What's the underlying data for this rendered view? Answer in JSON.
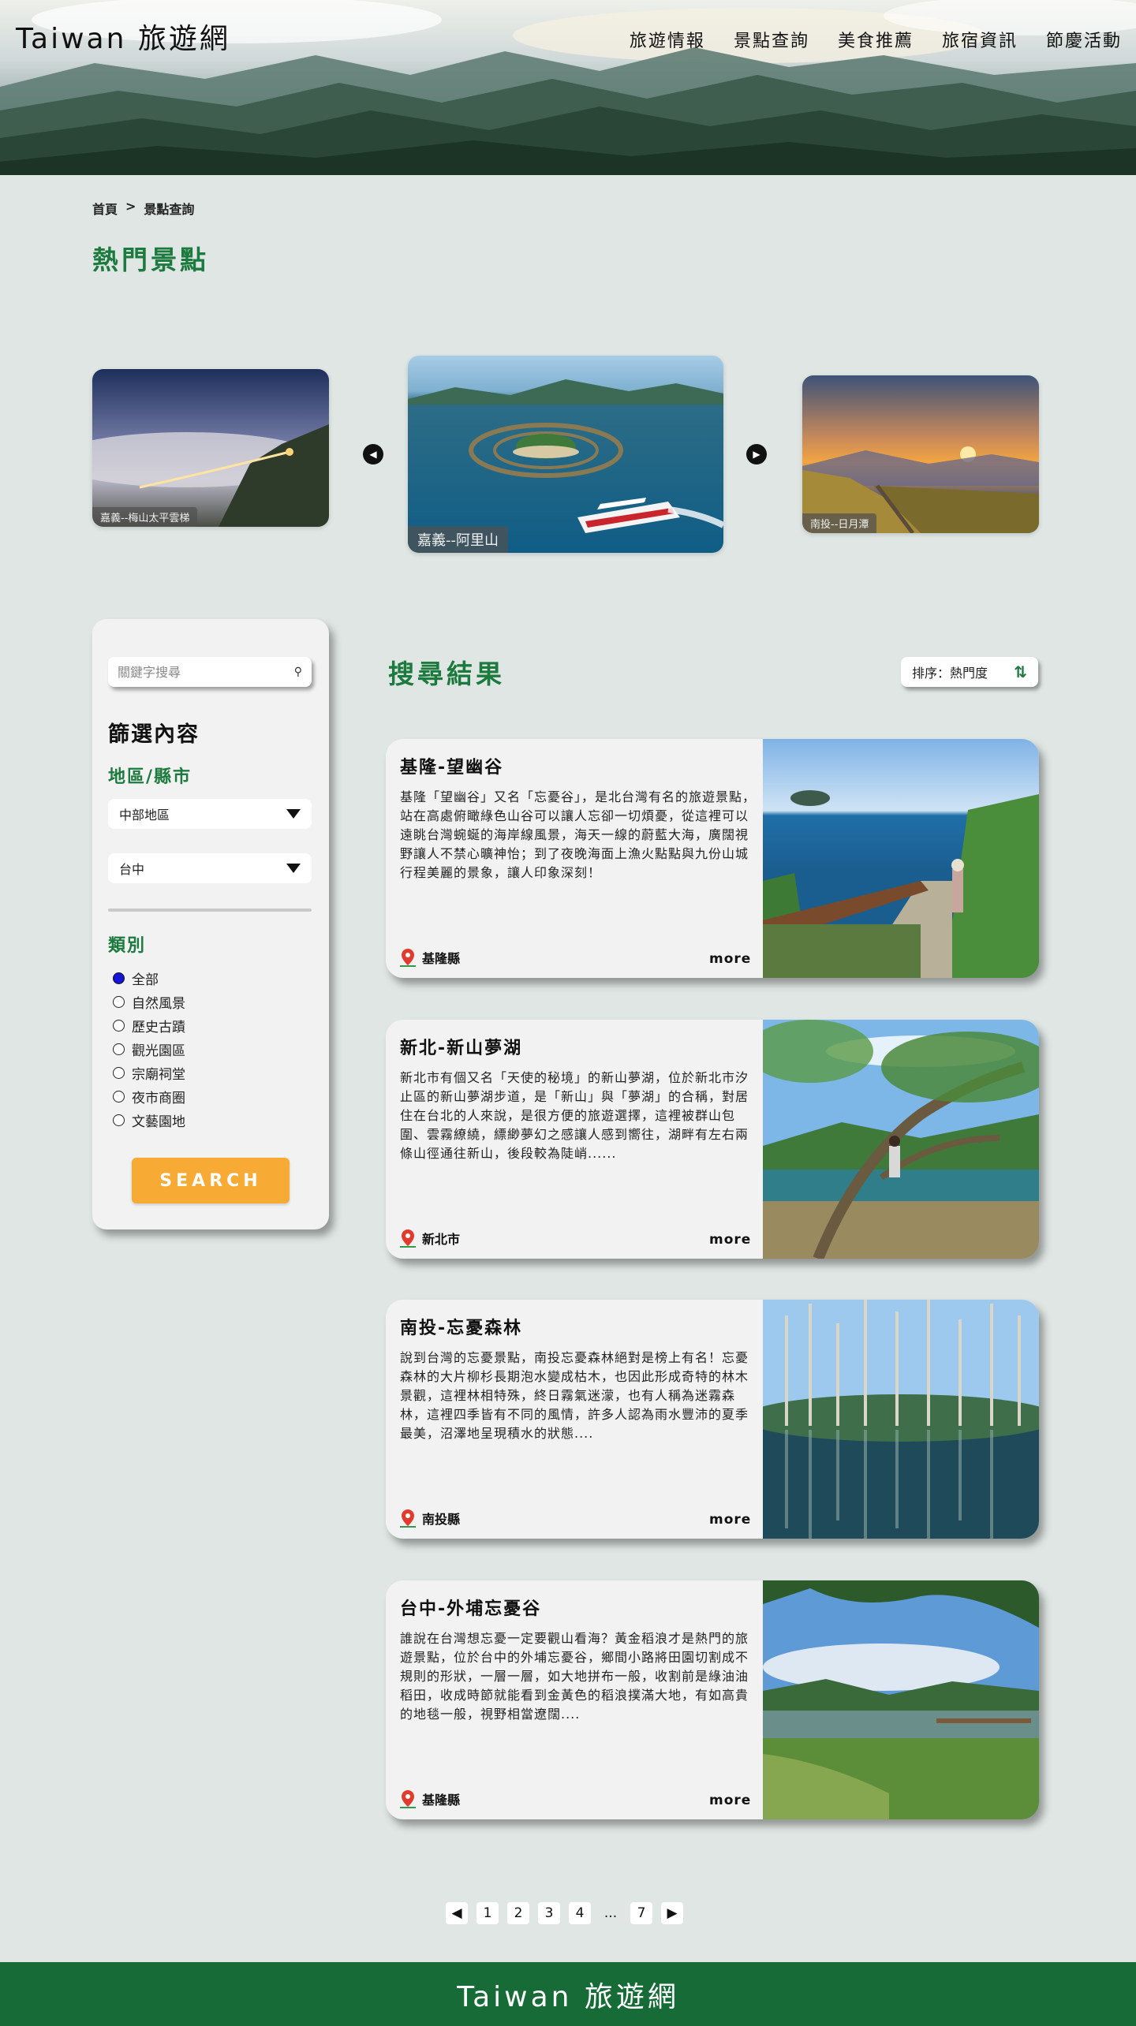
{
  "header": {
    "site_title": "Taiwan 旅遊網",
    "nav": [
      "旅遊情報",
      "景點查詢",
      "美食推薦",
      "旅宿資訊",
      "節慶活動"
    ]
  },
  "breadcrumb": {
    "home": "首頁",
    "separator": ">",
    "current": "景點查詢"
  },
  "page_title": "熱門景點",
  "carousel": {
    "prev_icon": "caret-left-icon",
    "next_icon": "caret-right-icon",
    "slides": [
      {
        "caption": "嘉義--梅山太平雲梯"
      },
      {
        "caption": "嘉義--阿里山"
      },
      {
        "caption": "南投--日月潭"
      }
    ]
  },
  "sidebar": {
    "search_placeholder": "關鍵字搜尋",
    "filter_title": "篩選內容",
    "region_title": "地區/縣市",
    "region_select": "中部地區",
    "city_select": "台中",
    "category_title": "類別",
    "categories": [
      "全部",
      "自然風景",
      "歷史古蹟",
      "觀光園區",
      "宗廟祠堂",
      "夜市商圈",
      "文藝園地"
    ],
    "selected_category": "全部",
    "search_button": "SEARCH"
  },
  "results": {
    "title": "搜尋結果",
    "sort_label": "排序：熱門度",
    "items": [
      {
        "title": "基隆-望幽谷",
        "desc": "基隆「望幽谷」又名「忘憂谷」，是北台灣有名的旅遊景點，站在高處俯瞰綠色山谷可以讓人忘卻一切煩憂，從這裡可以遠眺台灣蜿蜒的海岸線風景，海天一線的蔚藍大海，廣闊視野讓人不禁心曠神怡；到了夜晚海面上漁火點點與九份山城行程美麗的景象，讓人印象深刻！",
        "location": "基隆縣",
        "more": "more"
      },
      {
        "title": "新北-新山夢湖",
        "desc": "新北市有個又名「天使的秘境」的新山夢湖，位於新北市汐止區的新山夢湖步道，是「新山」與「夢湖」的合稱，對居住在台北的人來說，是很方便的旅遊選擇，這裡被群山包圍、雲霧繚繞，縹緲夢幻之感讓人感到嚮往，湖畔有左右兩條山徑通往新山，後段較為陡峭......",
        "location": "新北市",
        "more": "more"
      },
      {
        "title": "南投-忘憂森林",
        "desc": "說到台灣的忘憂景點，南投忘憂森林絕對是榜上有名！忘憂森林的大片柳杉長期泡水變成枯木，也因此形成奇特的林木景觀，這裡林相特殊，終日霧氣迷濛，也有人稱為迷霧森林，這裡四季皆有不同的風情，許多人認為雨水豐沛的夏季最美，沼澤地呈現積水的狀態....",
        "location": "南投縣",
        "more": "more"
      },
      {
        "title": "台中-外埔忘憂谷",
        "desc": "誰說在台灣想忘憂一定要觀山看海？黃金稻浪才是熱門的旅遊景點，位於台中的外埔忘憂谷，鄉間小路將田園切割成不規則的形狀，一層一層，如大地拼布一般，收割前是綠油油稻田，收成時節就能看到金黃色的稻浪撲滿大地，有如高貴的地毯一般，視野相當遼闊....",
        "location": "基隆縣",
        "more": "more"
      }
    ]
  },
  "pagination": {
    "prev": "◀",
    "pages": [
      "1",
      "2",
      "3",
      "4"
    ],
    "ellipsis": "...",
    "last": "7",
    "next": "▶"
  },
  "footer": {
    "title": "Taiwan 旅遊網"
  },
  "colors": {
    "accent_green": "#1c7a3e",
    "footer_green": "#176b36",
    "search_orange": "#f7ab34",
    "radio_blue": "#1515d8"
  }
}
